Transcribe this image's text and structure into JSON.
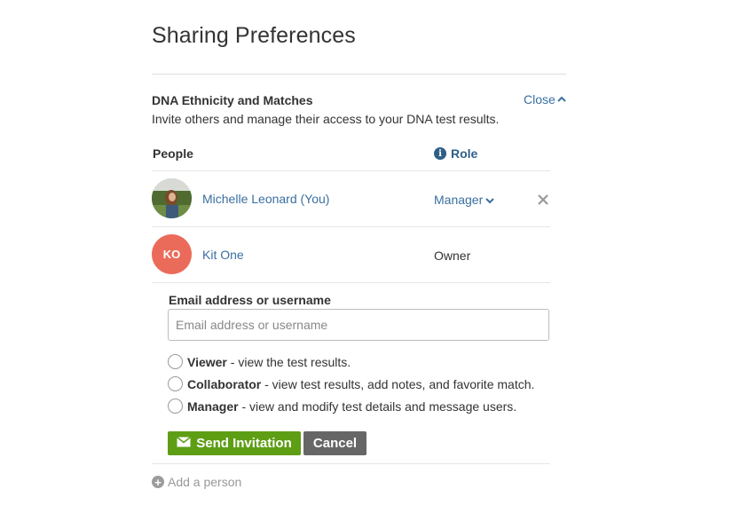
{
  "page": {
    "title": "Sharing Preferences"
  },
  "section": {
    "title": "DNA Ethnicity and Matches",
    "close_label": "Close",
    "description": "Invite others and manage their access to your DNA test results."
  },
  "table": {
    "headers": {
      "people": "People",
      "role": "Role"
    },
    "rows": [
      {
        "name": "Michelle Leonard (You)",
        "role": "Manager",
        "avatar": "photo",
        "removable": true
      },
      {
        "name": "Kit One",
        "initials": "KO",
        "role": "Owner",
        "avatar_color": "#eb6b5a"
      }
    ]
  },
  "invite": {
    "field_label": "Email address or username",
    "placeholder": "Email address or username",
    "value": "",
    "roles": [
      {
        "name": "Viewer",
        "description": " - view the test results."
      },
      {
        "name": "Collaborator",
        "description": " - view test results, add notes, and favorite match."
      },
      {
        "name": "Manager",
        "description": " - view and modify test details and message users."
      }
    ],
    "send_label": "Send Invitation",
    "cancel_label": "Cancel"
  },
  "footer": {
    "add_person_label": "Add a person"
  },
  "colors": {
    "link": "#3a6fa0",
    "send_button": "#5e9e15",
    "cancel_button": "#666666",
    "avatar_initials_bg": "#eb6b5a"
  },
  "icons": {
    "close_chevron": "chevron-up-icon",
    "role_info": "info-icon",
    "role_dropdown": "chevron-down-icon",
    "remove": "close-icon",
    "send": "envelope-icon",
    "add": "plus-circle-icon"
  }
}
